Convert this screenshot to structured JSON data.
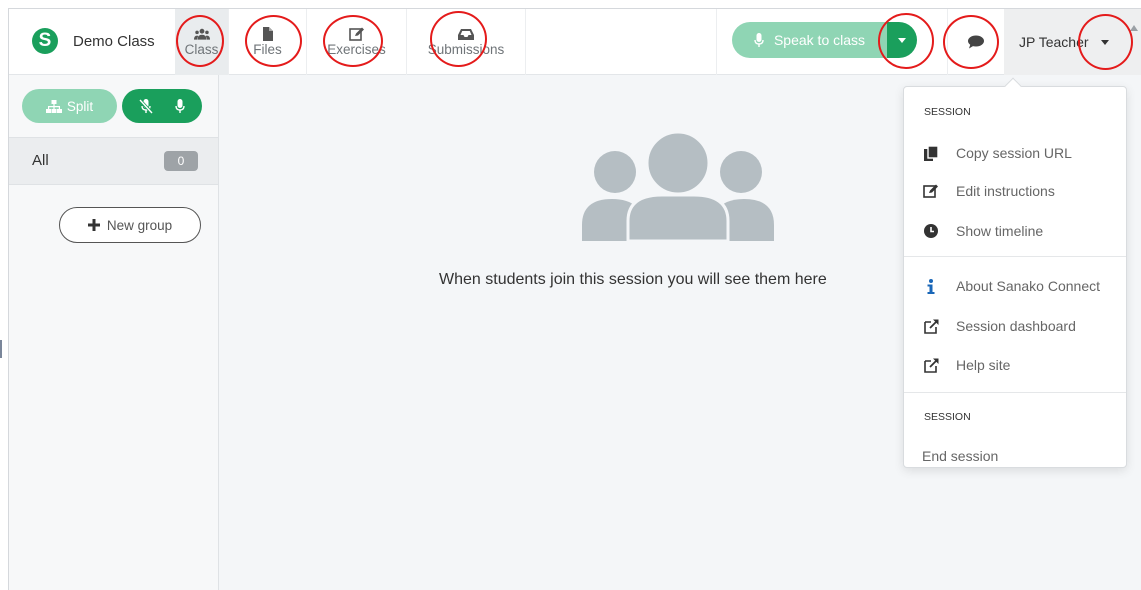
{
  "header": {
    "class_name": "Demo Class",
    "logo_letter": "S",
    "tabs": [
      {
        "label": "Class"
      },
      {
        "label": "Files"
      },
      {
        "label": "Exercises"
      },
      {
        "label": "Submissions"
      }
    ],
    "speak_label": "Speak to class",
    "user_name": "JP Teacher"
  },
  "sidebar": {
    "split_label": "Split",
    "all_label": "All",
    "all_count": "0",
    "new_group_label": "New group"
  },
  "main": {
    "empty_message": "When students join this session you will see them here"
  },
  "dropdown": {
    "section1_header": "SESSION",
    "items": [
      {
        "label": "Copy session URL",
        "icon": "copy-icon"
      },
      {
        "label": "Edit instructions",
        "icon": "edit-icon"
      },
      {
        "label": "Show timeline",
        "icon": "clock-icon"
      },
      {
        "label": "About Sanako Connect",
        "icon": "info-icon"
      },
      {
        "label": "Session dashboard",
        "icon": "external-link-icon"
      },
      {
        "label": "Help site",
        "icon": "external-link-icon"
      }
    ],
    "section2_header": "SESSION",
    "end_session_label": "End session"
  },
  "colors": {
    "brand_green": "#1a9f5c",
    "light_green": "#8fd5b4",
    "annotation_red": "#e41b1b"
  }
}
